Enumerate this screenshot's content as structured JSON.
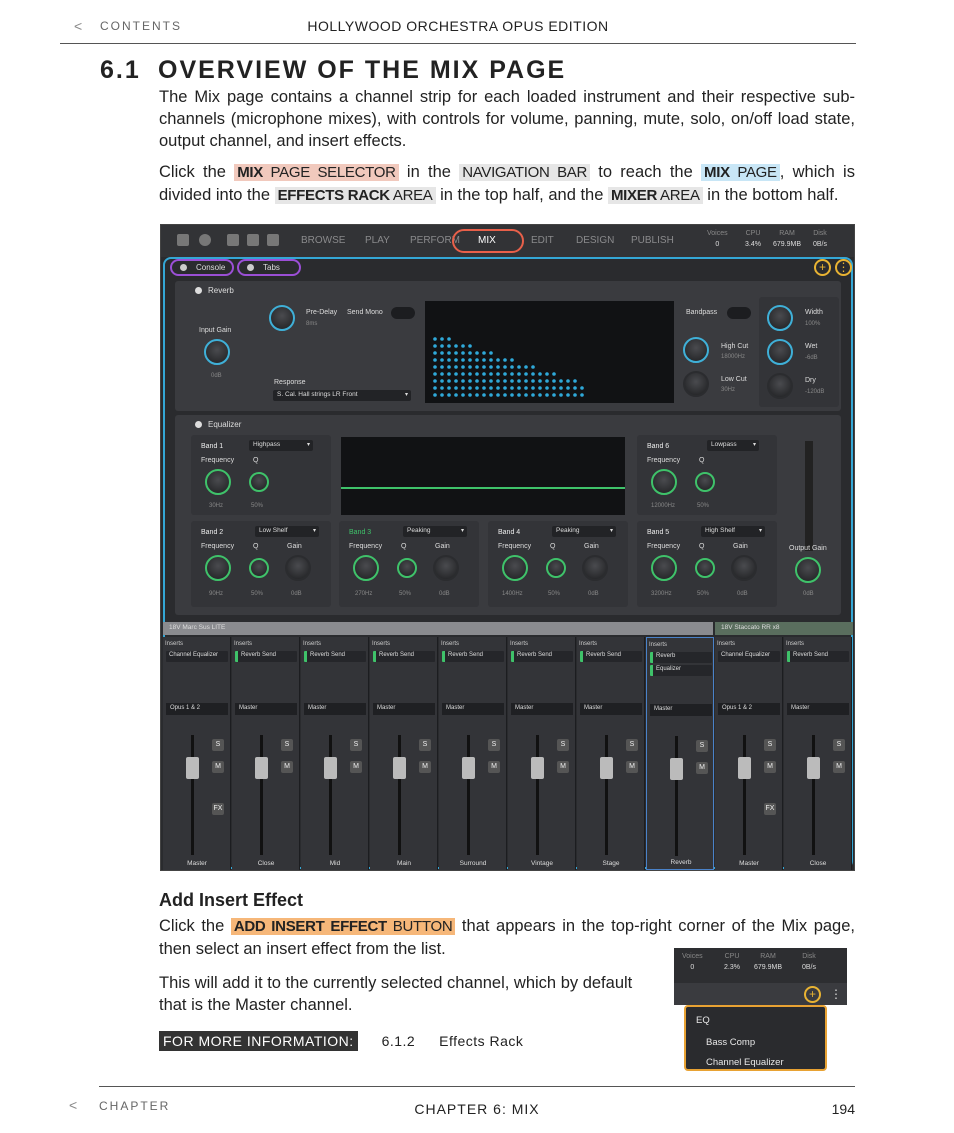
{
  "header": {
    "back": "<",
    "contents": "CONTENTS",
    "book": "HOLLYWOOD ORCHESTRA OPUS EDITION"
  },
  "section": {
    "number": "6.1",
    "title": "OVERVIEW OF THE MIX PAGE"
  },
  "intro": "The Mix page contains a channel strip for each loaded instrument and their respective sub-channels (microphone mixes), with controls for volume, panning, mute, solo, on/off load state, output channel, and insert effects.",
  "para2": {
    "p1": "Click the ",
    "tag1_b": "MIX",
    "tag1": " PAGE SELECTOR",
    "p2": " in the ",
    "tag2": "NAVIGATION BAR",
    "p3": " to reach the ",
    "tag3_b": "MIX",
    "tag3": " PAGE",
    "p4": ", which is divided into the ",
    "tag4_b": "EFFECTS RACK",
    "tag4": " AREA",
    "p5": " in the top half, and the ",
    "tag5_b": "MIXER",
    "tag5": " AREA",
    "p6": " in the bottom half."
  },
  "screenshot": {
    "nav": [
      "BROWSE",
      "PLAY",
      "PERFORM",
      "MIX",
      "EDIT",
      "DESIGN",
      "PUBLISH"
    ],
    "stats": [
      {
        "label": "Voices",
        "value": "0"
      },
      {
        "label": "CPU",
        "value": "3.4%"
      },
      {
        "label": "RAM",
        "value": "679.9MB"
      },
      {
        "label": "Disk",
        "value": "0B/s"
      }
    ],
    "tabs": [
      "Console",
      "Tabs"
    ],
    "reverb": {
      "title": "Reverb",
      "input_gain": "Input Gain",
      "input_gain_val": "0dB",
      "predelay": "Pre-Delay",
      "predelay_val": "8ms",
      "send_mono": "Send Mono",
      "response": "Response",
      "response_val": "S. Cal. Hall strings LR Front",
      "bandpass": "Bandpass",
      "high_cut": "High Cut",
      "high_cut_val": "18000Hz",
      "low_cut": "Low Cut",
      "low_cut_val": "30Hz",
      "width": "Width",
      "width_val": "100%",
      "wet": "Wet",
      "wet_val": "-6dB",
      "dry": "Dry",
      "dry_val": "-120dB"
    },
    "eq": {
      "title": "Equalizer",
      "output_gain": "Output Gain",
      "output_gain_val": "0dB",
      "freq": "Frequency",
      "q": "Q",
      "gain": "Gain",
      "band1": {
        "name": "Band 1",
        "type": "Highpass",
        "f": "30Hz",
        "q": "50%"
      },
      "band6": {
        "name": "Band 6",
        "type": "Lowpass",
        "f": "12000Hz",
        "q": "50%"
      },
      "band2": {
        "name": "Band 2",
        "type": "Low Shelf",
        "f": "90Hz",
        "q": "50%",
        "g": "0dB"
      },
      "band3": {
        "name": "Band 3",
        "type": "Peaking",
        "f": "270Hz",
        "q": "50%",
        "g": "0dB"
      },
      "band4": {
        "name": "Band 4",
        "type": "Peaking",
        "f": "1400Hz",
        "q": "50%",
        "g": "0dB"
      },
      "band5": {
        "name": "Band 5",
        "type": "High Shelf",
        "f": "3200Hz",
        "q": "50%",
        "g": "0dB"
      }
    },
    "groups": [
      "18V Marc Sus LITE",
      "18V Staccato RR x8"
    ],
    "strips": [
      {
        "name": "Master",
        "slot": "Channel Equalizer",
        "out": "Opus 1 & 2",
        "green": false
      },
      {
        "name": "Close",
        "slot": "Reverb Send",
        "out": "Master",
        "green": true
      },
      {
        "name": "Mid",
        "slot": "Reverb Send",
        "out": "Master",
        "green": true
      },
      {
        "name": "Main",
        "slot": "Reverb Send",
        "out": "Master",
        "green": true
      },
      {
        "name": "Surround",
        "slot": "Reverb Send",
        "out": "Master",
        "green": true
      },
      {
        "name": "Vintage",
        "slot": "Reverb Send",
        "out": "Master",
        "green": true
      },
      {
        "name": "Stage",
        "slot": "Reverb Send",
        "out": "Master",
        "green": true
      },
      {
        "name": "Reverb",
        "slot": "Reverb",
        "slot2": "Equalizer",
        "out": "Master",
        "green": true
      },
      {
        "name": "Master",
        "slot": "Channel Equalizer",
        "out": "Opus 1 & 2",
        "green": false
      },
      {
        "name": "Close",
        "slot": "Reverb Send",
        "out": "Master",
        "green": true
      }
    ],
    "inserts": "Inserts",
    "s": "S",
    "m": "M",
    "fx": "FX"
  },
  "add_insert": {
    "heading": "Add Insert Effect",
    "p1": "Click the ",
    "tag_b": "ADD INSERT EFFECT",
    "tag": " BUTTON",
    "p2": " that appears in the top-right corner of the Mix page, then select an insert effect from the list.",
    "para": "This will add it to the currently selected channel, which by default that is the Master channel."
  },
  "small_shot": {
    "stats": [
      {
        "label": "Voices",
        "value": "0"
      },
      {
        "label": "CPU",
        "value": "2.3%"
      },
      {
        "label": "RAM",
        "value": "679.9MB"
      },
      {
        "label": "Disk",
        "value": "0B/s"
      }
    ],
    "menu": [
      "EQ",
      "Bass Comp",
      "Channel Equalizer"
    ]
  },
  "info": {
    "label": "FOR MORE INFORMATION:",
    "ref_num": "6.1.2",
    "ref_title": "Effects Rack"
  },
  "footer": {
    "back": "<",
    "chapter": "CHAPTER",
    "title": "CHAPTER 6:  MIX",
    "page": "194"
  }
}
